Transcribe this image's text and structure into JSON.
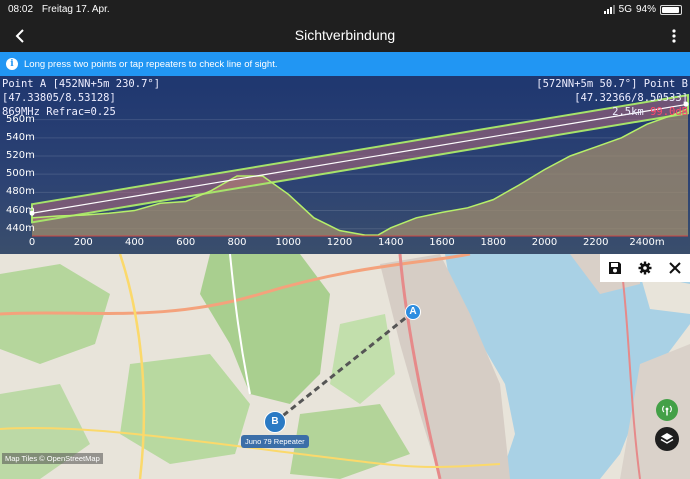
{
  "status_bar": {
    "time": "08:02",
    "date": "Freitag 17. Apr.",
    "network": "5G",
    "battery": "94%",
    "battery_level": 0.94
  },
  "app_bar": {
    "title": "Sichtverbindung"
  },
  "banner": {
    "text": "Long press two points or tap repeaters to check line of sight."
  },
  "profile": {
    "point_a": {
      "title": "Point A [452NN+5m 230.7°]",
      "coords": "[47.33805/8.53128]",
      "freq": "869MHz Refrac=0.25"
    },
    "point_b": {
      "title": "[572NN+5m 50.7°] Point B",
      "coords": "[47.32366/8.50533]",
      "distance": "2.5km",
      "loss": "99.0dB"
    },
    "colors": {
      "terrain_stroke": "#b6f06a",
      "fresnel_fill": "#b06a7a",
      "fresnel_stroke": "#a6e36a",
      "los_line": "#ffffff",
      "loss": "#ff4a6a"
    }
  },
  "chart_data": {
    "type": "area",
    "xlim": [
      0,
      2560
    ],
    "ylim": [
      432,
      575
    ],
    "x_ticks": [
      "0",
      "200",
      "400",
      "600",
      "800",
      "1000",
      "1200",
      "1400",
      "1600",
      "1800",
      "2000",
      "2200",
      "2400m"
    ],
    "y_ticks": [
      "440m",
      "460m",
      "480m",
      "500m",
      "520m",
      "540m",
      "560m"
    ],
    "y_tick_values": [
      440,
      460,
      480,
      500,
      520,
      540,
      560
    ],
    "x_tick_values": [
      0,
      200,
      400,
      600,
      800,
      1000,
      1200,
      1400,
      1600,
      1800,
      2000,
      2200,
      2400
    ],
    "line_of_sight": {
      "start": [
        0,
        457
      ],
      "end": [
        2560,
        577
      ]
    },
    "fresnel_halfwidth": 10,
    "terrain": {
      "x": [
        0,
        100,
        200,
        300,
        400,
        500,
        600,
        700,
        800,
        900,
        1000,
        1100,
        1200,
        1300,
        1350,
        1400,
        1500,
        1600,
        1700,
        1800,
        1900,
        2000,
        2100,
        2200,
        2300,
        2400,
        2500,
        2560
      ],
      "y": [
        452,
        454,
        455,
        457,
        460,
        468,
        470,
        482,
        498,
        498,
        478,
        452,
        438,
        433,
        433,
        441,
        452,
        458,
        463,
        472,
        488,
        505,
        520,
        530,
        540,
        555,
        565,
        572
      ]
    }
  },
  "map": {
    "marker_a": "A",
    "marker_b": "B",
    "marker_b_label": "Juno 79 Repeater",
    "attribution": "Map Tiles © OpenStreetMap",
    "toolbar": {
      "save": "save-icon",
      "settings": "gear-icon",
      "close": "close-icon"
    }
  }
}
